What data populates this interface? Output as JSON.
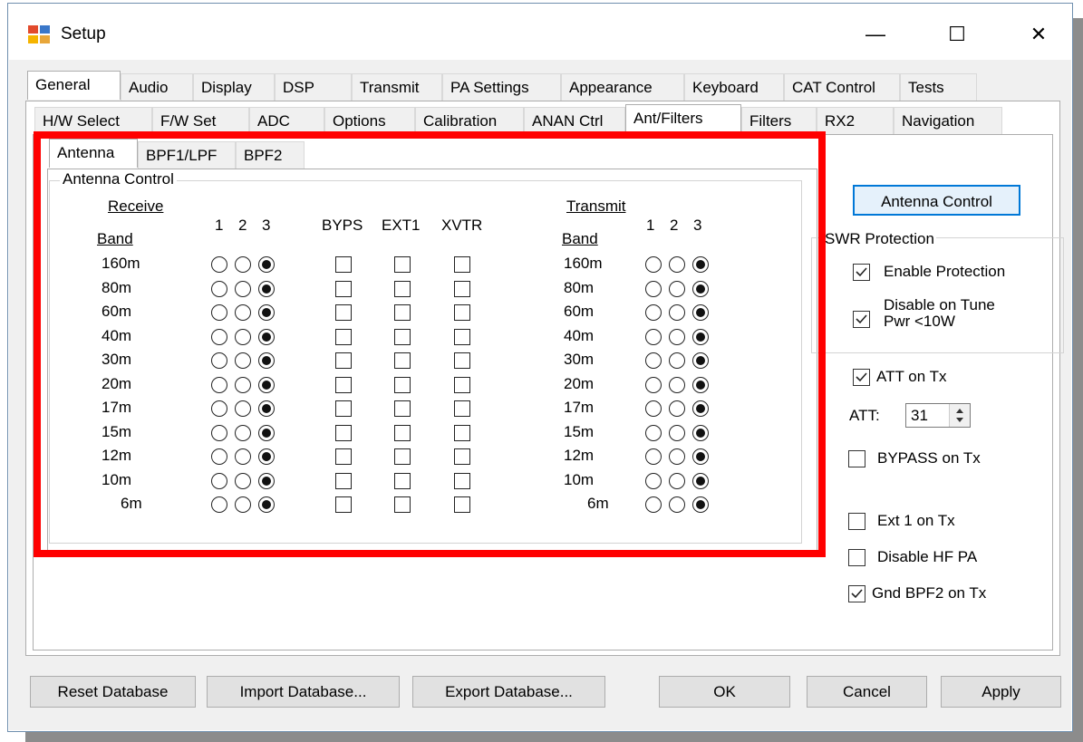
{
  "window": {
    "title": "Setup",
    "minimize": "—",
    "maximize": "☐",
    "close": "✕"
  },
  "main_tabs": [
    "General",
    "Audio",
    "Display",
    "DSP",
    "Transmit",
    "PA Settings",
    "Appearance",
    "Keyboard",
    "CAT Control",
    "Tests"
  ],
  "sub_tabs": [
    "H/W Select",
    "F/W Set",
    "ADC",
    "Options",
    "Calibration",
    "ANAN Ctrl",
    "Ant/Filters",
    "Filters",
    "RX2",
    "Navigation"
  ],
  "ant_tabs": [
    "Antenna",
    "BPF1/LPF",
    "BPF2"
  ],
  "antenna_control": {
    "group_label": "Antenna Control",
    "receive_label": "Receive",
    "transmit_label": "Transmit",
    "band_label": "Band",
    "rx_cols": [
      "1",
      "2",
      "3"
    ],
    "tx_cols": [
      "1",
      "2",
      "3"
    ],
    "byps_label": "BYPS",
    "ext1_label": "EXT1",
    "xvtr_label": "XVTR",
    "bands": [
      "160m",
      "80m",
      "60m",
      "40m",
      "30m",
      "20m",
      "17m",
      "15m",
      "12m",
      "10m",
      "6m"
    ],
    "rx_selected": 3,
    "tx_selected": 3
  },
  "right": {
    "antenna_control_button": "Antenna Control",
    "swr_group": "SWR Protection",
    "enable_protection": "Enable Protection",
    "disable_on_tune_1": "Disable on Tune",
    "disable_on_tune_2": "Pwr <10W",
    "att_on_tx": "ATT on Tx",
    "att_label": "ATT:",
    "att_value": "31",
    "bypass_on_tx": "BYPASS on Tx",
    "ext1_on_tx": "Ext 1 on Tx",
    "disable_hf_pa": "Disable HF PA",
    "gnd_bpf2": "Gnd BPF2 on Tx"
  },
  "checks": {
    "enable_protection": true,
    "disable_on_tune": true,
    "att_on_tx": true,
    "bypass_on_tx": false,
    "ext1_on_tx": false,
    "disable_hf_pa": false,
    "gnd_bpf2": true
  },
  "buttons": {
    "reset": "Reset Database",
    "import": "Import Database...",
    "export": "Export Database...",
    "ok": "OK",
    "cancel": "Cancel",
    "apply": "Apply"
  }
}
